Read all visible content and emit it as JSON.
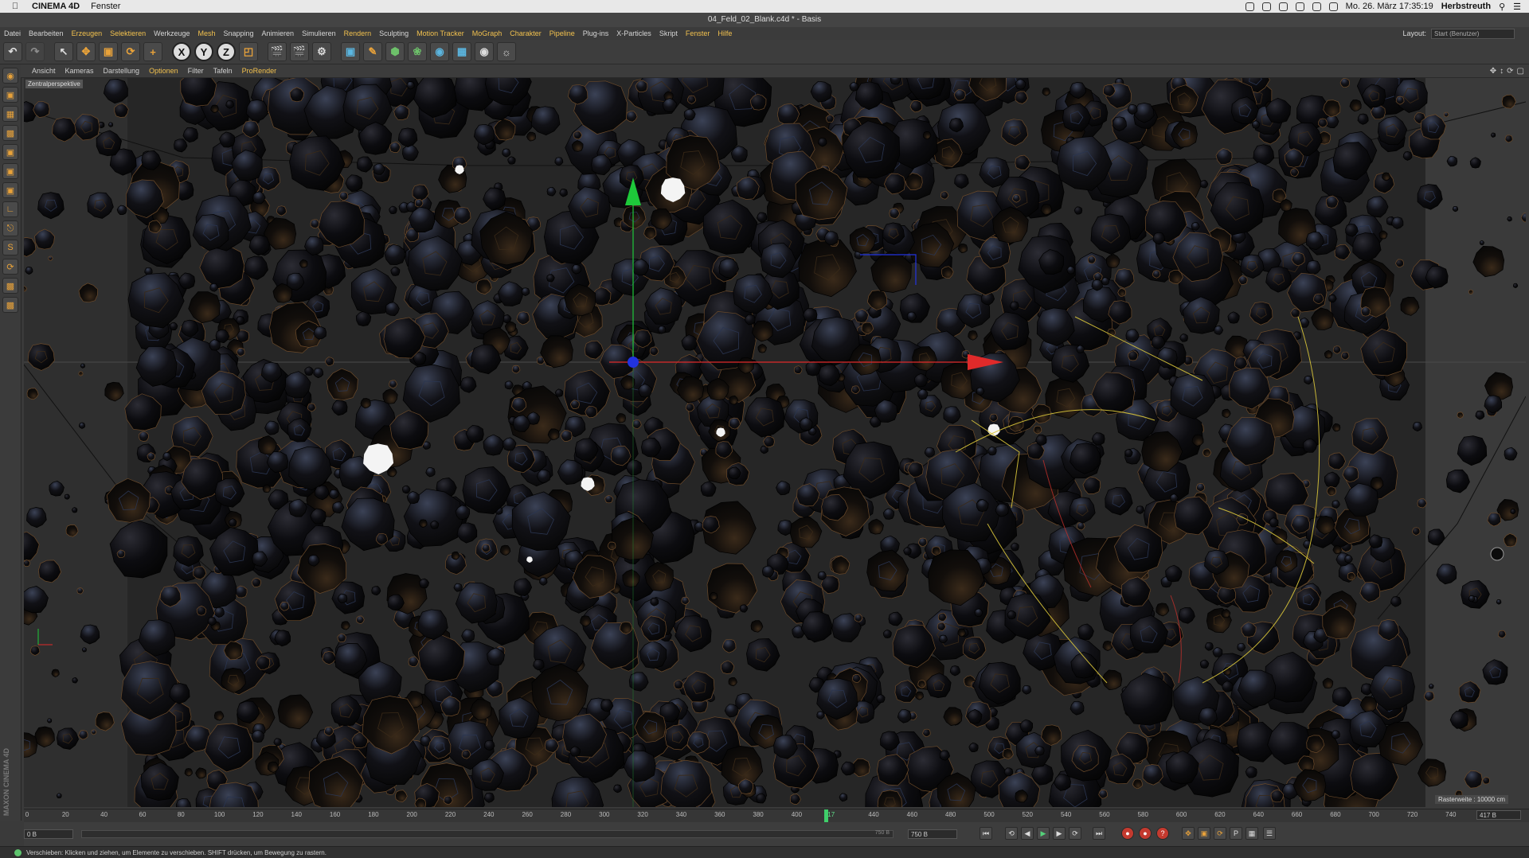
{
  "macbar": {
    "app_name": "CINEMA 4D",
    "menu": "Fenster",
    "datetime": "Mo. 26. März  17:35:19",
    "user": "Herbstreuth"
  },
  "window": {
    "title": "04_Feld_02_Blank.c4d * - Basis"
  },
  "menubar": {
    "items": [
      {
        "label": "Datei",
        "highlight": false
      },
      {
        "label": "Bearbeiten",
        "highlight": false
      },
      {
        "label": "Erzeugen",
        "highlight": true
      },
      {
        "label": "Selektieren",
        "highlight": true
      },
      {
        "label": "Werkzeuge",
        "highlight": false
      },
      {
        "label": "Mesh",
        "highlight": true
      },
      {
        "label": "Snapping",
        "highlight": false
      },
      {
        "label": "Animieren",
        "highlight": false
      },
      {
        "label": "Simulieren",
        "highlight": false
      },
      {
        "label": "Rendern",
        "highlight": true
      },
      {
        "label": "Sculpting",
        "highlight": false
      },
      {
        "label": "Motion Tracker",
        "highlight": true
      },
      {
        "label": "MoGraph",
        "highlight": true
      },
      {
        "label": "Charakter",
        "highlight": true
      },
      {
        "label": "Pipeline",
        "highlight": true
      },
      {
        "label": "Plug-ins",
        "highlight": false
      },
      {
        "label": "X-Particles",
        "highlight": false
      },
      {
        "label": "Skript",
        "highlight": false
      },
      {
        "label": "Fenster",
        "highlight": true
      },
      {
        "label": "Hilfe",
        "highlight": true
      }
    ],
    "layout_label": "Layout:",
    "layout_value": "Start (Benutzer)"
  },
  "toolbar": {
    "axis_x": "X",
    "axis_y": "Y",
    "axis_z": "Z"
  },
  "viewport": {
    "menu": [
      {
        "label": "Ansicht",
        "highlight": false
      },
      {
        "label": "Kameras",
        "highlight": false
      },
      {
        "label": "Darstellung",
        "highlight": false
      },
      {
        "label": "Optionen",
        "highlight": true
      },
      {
        "label": "Filter",
        "highlight": false
      },
      {
        "label": "Tafeln",
        "highlight": false
      },
      {
        "label": "ProRender",
        "highlight": true
      }
    ],
    "camera_label": "Zentralperspektive",
    "grid_label": "Rasterweite : 10000 cm"
  },
  "timeline": {
    "ticks": [
      0,
      20,
      40,
      60,
      80,
      100,
      120,
      140,
      160,
      180,
      200,
      220,
      240,
      260,
      280,
      300,
      320,
      340,
      360,
      380,
      400,
      417,
      440,
      460,
      480,
      500,
      520,
      540,
      560,
      580,
      600,
      620,
      640,
      660,
      680,
      700,
      720,
      740
    ],
    "current_frame": 417,
    "current_frame_field": "417 B",
    "max_frame": 750
  },
  "transport": {
    "start_field": "0 B",
    "end_field": "750 B",
    "range_end_label": "750 B"
  },
  "status": {
    "text": "Verschieben: Klicken und ziehen, um Elemente zu verschieben. SHIFT drücken, um Bewegung zu rastern."
  },
  "brand": "MAXON CINEMA 4D",
  "colors": {
    "accent": "#f2c14e",
    "x_axis": "#e02a2a",
    "y_axis": "#1ec83a",
    "z_axis": "#2233e0",
    "play": "#55d07a",
    "record": "#c43a2f"
  }
}
